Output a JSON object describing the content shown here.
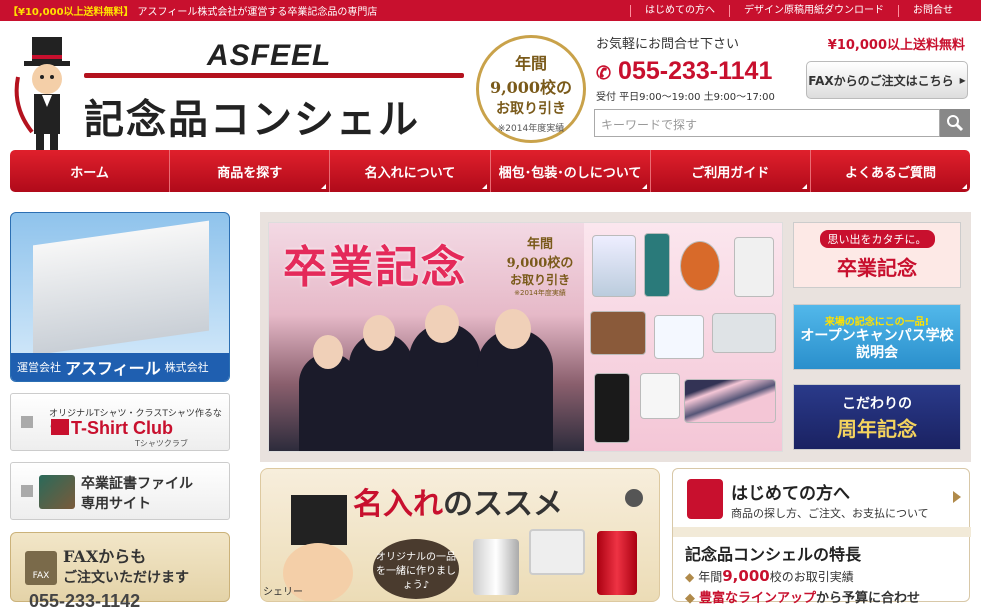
{
  "topbar": {
    "free_label": "【¥10,000以上送料無料】",
    "tagline": "アスフィール株式会社が運営する卒業記念品の専門店",
    "links": [
      "はじめての方へ",
      "デザイン原稿用紙ダウンロード",
      "お問合せ"
    ]
  },
  "header": {
    "brand": "ASFEEL",
    "site_name": "記念品コンシェル",
    "badge": {
      "line1": "年間",
      "line2": "9,000校の",
      "line3": "お取り引き",
      "note": "※2014年度実績"
    },
    "contact_lead": "お気軽にお問合せ下さい",
    "free_shipping": "¥10,000以上送料無料",
    "phone": "055-233-1141",
    "hours": "受付 平日9:00〜19:00 土9:00〜17:00",
    "fax_button": "FAXからのご注文はこちら",
    "search_placeholder": "キーワードで探す"
  },
  "nav": [
    "ホーム",
    "商品を探す",
    "名入れについて",
    "梱包･包装･のしについて",
    "ご利用ガイド",
    "よくあるご質問"
  ],
  "sidebar": {
    "company_prefix": "運営会社",
    "company_name": "アスフィール",
    "company_suffix": "株式会社",
    "shirt_small": "オリジナルTシャツ・クラスTシャツ作るなら",
    "shirt_logo": "T-Shirt Club",
    "shirt_sub": "Tシャツクラブ",
    "file_line1": "卒業証書ファイル",
    "file_line2": "専用サイト",
    "fax_line1": "FAXからも",
    "fax_line2": "ご注文いただけます",
    "fax_icon": "FAX",
    "fax_number": "055-233-1142"
  },
  "hero": {
    "title": "卒業記念",
    "seal_line1": "年間",
    "seal_line2": "9,000校の",
    "seal_line3": "お取り引き",
    "seal_note": "※2014年度実績"
  },
  "side_banners": [
    {
      "small": "思い出をカタチに。",
      "big": "卒業記念"
    },
    {
      "small": "来場の記念にこの一品!",
      "big": "オープンキャンパス学校説明会"
    },
    {
      "small": "こだわりの",
      "big": "周年記念"
    }
  ],
  "namae": {
    "title_red": "名入れ",
    "title_rest": "のススメ",
    "bubble": "オリジナルの一品を一緒に作りましょう♪",
    "mascot_label": "シェリー"
  },
  "info": {
    "first_title": "はじめての方へ",
    "first_sub": "商品の探し方、ご注文、お支払について",
    "features_title": "記念品コンシェルの特長",
    "feature1_pre": "年間",
    "feature1_num": "9,000",
    "feature1_post": "校のお取引実績",
    "feature2_red": "豊富なラインアップ",
    "feature2_rest": "から予算に合わせ"
  }
}
